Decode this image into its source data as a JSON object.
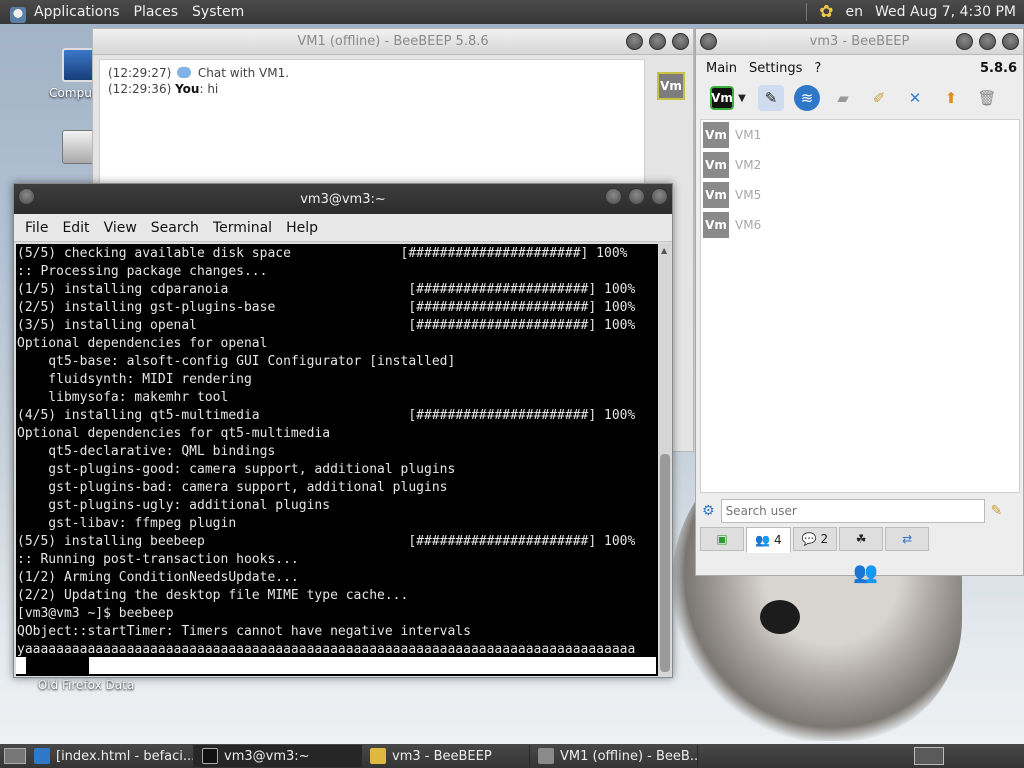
{
  "top_panel": {
    "menus": [
      "Applications",
      "Places",
      "System"
    ],
    "keyboard_layout": "en",
    "clock": "Wed Aug  7,  4:30 PM"
  },
  "desktop": {
    "icons": [
      {
        "label": "Computer"
      },
      {
        "label": "Old Firefox Data"
      }
    ]
  },
  "vm1_window": {
    "title": "VM1 (offline) - BeeBEEP 5.8.6",
    "messages": [
      {
        "time": "(12:29:27)",
        "sender": "",
        "text": "Chat with VM1."
      },
      {
        "time": "(12:29:36)",
        "sender": "You",
        "text": ": hi"
      }
    ],
    "avatar_label": "Vm"
  },
  "terminal": {
    "title": "vm3@vm3:~",
    "menu": [
      "File",
      "Edit",
      "View",
      "Search",
      "Terminal",
      "Help"
    ],
    "lines": [
      "(5/5) checking available disk space              [######################] 100%",
      ":: Processing package changes...",
      "(1/5) installing cdparanoia                       [######################] 100%",
      "(2/5) installing gst-plugins-base                 [######################] 100%",
      "(3/5) installing openal                           [######################] 100%",
      "Optional dependencies for openal",
      "    qt5-base: alsoft-config GUI Configurator [installed]",
      "    fluidsynth: MIDI rendering",
      "    libmysofa: makemhr tool",
      "(4/5) installing qt5-multimedia                   [######################] 100%",
      "Optional dependencies for qt5-multimedia",
      "    qt5-declarative: QML bindings",
      "    gst-plugins-good: camera support, additional plugins",
      "    gst-plugins-bad: camera support, additional plugins",
      "    gst-plugins-ugly: additional plugins",
      "    gst-libav: ffmpeg plugin",
      "(5/5) installing beebeep                          [######################] 100%",
      ":: Running post-transaction hooks...",
      "(1/2) Arming ConditionNeedsUpdate...",
      "(2/2) Updating the desktop file MIME type cache...",
      "[vm3@vm3 ~]$ beebeep",
      "QObject::startTimer: Timers cannot have negative intervals",
      "yaaaaaaaaaaaaaaaaaaaaaaaaaaaaaaaaaaaaaaaaaaaaaaaaaaaaaaaaaaaaaaaaaaaaaaaaaaaaaa"
    ]
  },
  "beebeep": {
    "title": "vm3 - BeeBEEP",
    "menu": {
      "main": "Main",
      "settings": "Settings",
      "help": "?",
      "version": "5.8.6"
    },
    "toolbar_vm_label": "Vm",
    "users": [
      {
        "avatar": "Vm",
        "name": "VM1"
      },
      {
        "avatar": "Vm",
        "name": "VM2"
      },
      {
        "avatar": "Vm",
        "name": "VM5"
      },
      {
        "avatar": "Vm",
        "name": "VM6"
      }
    ],
    "search_placeholder": "Search user",
    "tabs": {
      "users_count": "4",
      "chats_count": "2"
    }
  },
  "taskbar": {
    "tasks": [
      {
        "label": "[index.html - befaci..."
      },
      {
        "label": "vm3@vm3:~"
      },
      {
        "label": "vm3 - BeeBEEP"
      },
      {
        "label": "VM1 (offline) - BeeB..."
      }
    ]
  },
  "colors": {
    "panel_bg": "#3d3d3d",
    "terminal_bg": "#000000",
    "accent_green": "#3cb03c",
    "avatar_grey": "#8a8a8a"
  }
}
